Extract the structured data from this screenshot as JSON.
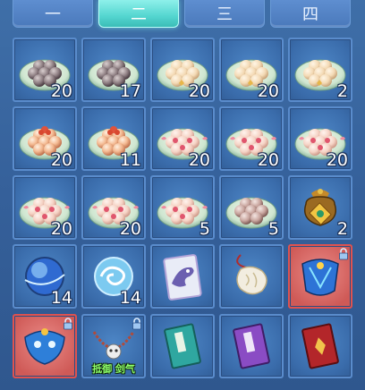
{
  "tabs": [
    {
      "label": "一",
      "active": false
    },
    {
      "label": "二",
      "active": true
    },
    {
      "label": "三",
      "active": false
    },
    {
      "label": "四",
      "active": false
    }
  ],
  "items": [
    {
      "icon": "dark-dumpling-plate-icon",
      "count": "20"
    },
    {
      "icon": "dark-dumpling-plate-icon",
      "count": "17"
    },
    {
      "icon": "cream-dumpling-plate-icon",
      "count": "20"
    },
    {
      "icon": "cream-dumpling-plate-icon",
      "count": "20"
    },
    {
      "icon": "cream-dumpling-plate-icon",
      "count": "2"
    },
    {
      "icon": "orange-dumpling-plate-icon",
      "count": "20"
    },
    {
      "icon": "orange-dumpling-plate-icon",
      "count": "11"
    },
    {
      "icon": "rose-dumpling-plate-icon",
      "count": "20"
    },
    {
      "icon": "rose-dumpling-plate-icon",
      "count": "20"
    },
    {
      "icon": "rose-dumpling-plate-icon",
      "count": "20"
    },
    {
      "icon": "rose-dumpling-plate-icon",
      "count": "20"
    },
    {
      "icon": "rose-dumpling-plate-icon",
      "count": "20"
    },
    {
      "icon": "rose-dumpling-plate-icon",
      "count": "5"
    },
    {
      "icon": "brown-dumpling-plate-icon",
      "count": "5"
    },
    {
      "icon": "treasure-pouch-icon",
      "count": "2"
    },
    {
      "icon": "blue-orb-icon",
      "count": "14"
    },
    {
      "icon": "swirl-orb-icon",
      "count": "14"
    },
    {
      "icon": "beast-card-icon",
      "count": ""
    },
    {
      "icon": "jade-pendant-icon",
      "count": ""
    },
    {
      "icon": "blue-armor-icon",
      "count": "",
      "locked": true,
      "frame": "pink"
    },
    {
      "icon": "blue-mask-icon",
      "count": "",
      "locked": true,
      "frame": "pink"
    },
    {
      "icon": "skull-necklace-icon",
      "count": "",
      "locked": true,
      "tag": "抵御 剑气"
    },
    {
      "icon": "teal-book-icon",
      "count": ""
    },
    {
      "icon": "purple-book-icon",
      "count": ""
    },
    {
      "icon": "red-book-icon",
      "count": ""
    }
  ],
  "colors": {
    "panel_bg": "#3a6cab",
    "cell_border": "#5a8ccc",
    "active_tab": "#54d6d0",
    "pink_frame": "#e0524f",
    "tag_text": "#8dff6b"
  }
}
